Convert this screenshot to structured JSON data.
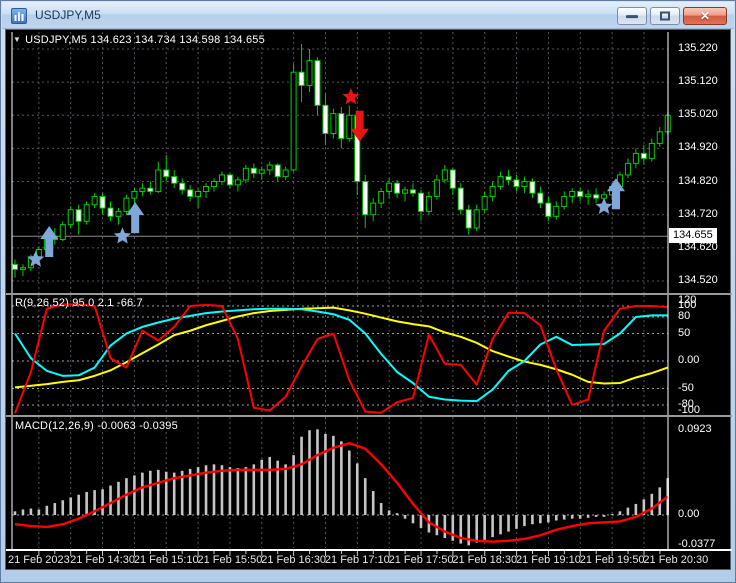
{
  "window": {
    "title": "USDJPY,M5",
    "buttons": {
      "minimize": "minimize",
      "restore": "restore",
      "close_glyph": "✕"
    }
  },
  "legend": {
    "arrow": "▼",
    "text": "USDJPY,M5 134.623 134.734 134.598 134.655"
  },
  "colors": {
    "background": "#000000",
    "grid": "#555562",
    "candle_outline": "#00CE00",
    "bull_fill": "#000000",
    "bear_fill": "#FFFFFF",
    "r_fast": "#FF0000",
    "r_mid": "#00FFFF",
    "r_slow": "#FFFF00",
    "macd_hist": "#C6C6C6",
    "macd_signal": "#FF0000",
    "marker_blue": "#7FA8D9",
    "marker_red": "#E81414",
    "frame": "#FFFFFF",
    "separator": "#9A9A9A",
    "price_line": "#8C8C8C",
    "axis_text": "#FFFFFF"
  },
  "chart_data": {
    "type": "candlestick",
    "symbol": "USDJPY",
    "timeframe": "M5",
    "last_ohlc": {
      "open": "134.623",
      "high": "134.734",
      "low": "134.598",
      "close": "134.655"
    },
    "current_price": 134.655,
    "price_ticks": [
      135.22,
      135.12,
      135.02,
      134.92,
      134.82,
      134.72,
      134.62,
      134.52
    ],
    "time_labels": [
      "21 Feb 2023",
      "21 Feb 14:30",
      "21 Feb 15:10",
      "21 Feb 15:50",
      "21 Feb 16:30",
      "21 Feb 17:10",
      "21 Feb 17:50",
      "21 Feb 18:30",
      "21 Feb 19:10",
      "21 Feb 19:50",
      "21 Feb 20:30"
    ],
    "candles": [
      [
        134.57,
        134.585,
        134.53,
        134.555
      ],
      [
        134.555,
        134.57,
        134.535,
        134.56
      ],
      [
        134.56,
        134.6,
        134.55,
        134.59
      ],
      [
        134.59,
        134.625,
        134.575,
        134.615
      ],
      [
        134.615,
        134.665,
        134.6,
        134.655
      ],
      [
        134.655,
        134.68,
        134.63,
        134.645
      ],
      [
        134.645,
        134.7,
        134.64,
        134.69
      ],
      [
        134.69,
        134.745,
        134.68,
        134.735
      ],
      [
        134.735,
        134.75,
        134.66,
        134.7
      ],
      [
        134.7,
        134.76,
        134.69,
        134.75
      ],
      [
        134.75,
        134.785,
        134.74,
        134.775
      ],
      [
        134.775,
        134.785,
        134.72,
        134.74
      ],
      [
        134.74,
        134.76,
        134.7,
        134.715
      ],
      [
        134.715,
        134.74,
        134.69,
        134.73
      ],
      [
        134.73,
        134.78,
        134.72,
        134.77
      ],
      [
        134.77,
        134.8,
        134.755,
        134.79
      ],
      [
        134.79,
        134.815,
        134.775,
        134.8
      ],
      [
        134.8,
        134.82,
        134.78,
        134.79
      ],
      [
        134.79,
        134.88,
        134.785,
        134.855
      ],
      [
        134.855,
        134.9,
        134.82,
        134.835
      ],
      [
        134.835,
        134.855,
        134.8,
        134.815
      ],
      [
        134.815,
        134.83,
        134.78,
        134.795
      ],
      [
        134.795,
        134.81,
        134.76,
        134.775
      ],
      [
        134.775,
        134.8,
        134.74,
        134.79
      ],
      [
        134.79,
        134.815,
        134.77,
        134.805
      ],
      [
        134.805,
        134.83,
        134.79,
        134.82
      ],
      [
        134.82,
        134.85,
        134.81,
        134.84
      ],
      [
        134.84,
        134.845,
        134.8,
        134.81
      ],
      [
        134.81,
        134.835,
        134.79,
        134.825
      ],
      [
        134.825,
        134.87,
        134.815,
        134.86
      ],
      [
        134.86,
        134.875,
        134.83,
        134.845
      ],
      [
        134.845,
        134.865,
        134.825,
        134.855
      ],
      [
        134.855,
        134.88,
        134.84,
        134.87
      ],
      [
        134.87,
        134.875,
        134.82,
        134.835
      ],
      [
        134.835,
        134.865,
        134.825,
        134.855
      ],
      [
        134.855,
        135.175,
        134.85,
        135.15
      ],
      [
        135.15,
        135.235,
        135.06,
        135.11
      ],
      [
        135.11,
        135.22,
        135.09,
        135.185
      ],
      [
        135.185,
        135.195,
        135.02,
        135.05
      ],
      [
        135.05,
        135.085,
        134.93,
        134.965
      ],
      [
        134.965,
        135.04,
        134.95,
        135.025
      ],
      [
        135.025,
        135.045,
        134.92,
        134.95
      ],
      [
        134.95,
        135.05,
        134.94,
        135.02
      ],
      [
        135.02,
        135.035,
        134.78,
        134.82
      ],
      [
        134.82,
        134.84,
        134.68,
        134.72
      ],
      [
        134.72,
        134.77,
        134.7,
        134.755
      ],
      [
        134.755,
        134.8,
        134.74,
        134.79
      ],
      [
        134.79,
        134.83,
        134.77,
        134.815
      ],
      [
        134.815,
        134.825,
        134.77,
        134.785
      ],
      [
        134.785,
        134.805,
        134.76,
        134.795
      ],
      [
        134.795,
        134.815,
        134.775,
        134.785
      ],
      [
        134.785,
        134.795,
        134.7,
        134.73
      ],
      [
        134.73,
        134.79,
        134.72,
        134.775
      ],
      [
        134.775,
        134.84,
        134.765,
        134.825
      ],
      [
        134.825,
        134.87,
        134.815,
        134.855
      ],
      [
        134.855,
        134.86,
        134.78,
        134.8
      ],
      [
        134.8,
        134.815,
        134.72,
        134.735
      ],
      [
        134.735,
        134.75,
        134.66,
        134.68
      ],
      [
        134.68,
        134.75,
        134.67,
        134.735
      ],
      [
        134.735,
        134.79,
        134.725,
        134.775
      ],
      [
        134.775,
        134.82,
        134.76,
        134.805
      ],
      [
        134.805,
        134.85,
        134.795,
        134.835
      ],
      [
        134.835,
        134.855,
        134.81,
        134.825
      ],
      [
        134.825,
        134.84,
        134.79,
        134.805
      ],
      [
        134.805,
        134.835,
        134.785,
        134.82
      ],
      [
        134.82,
        134.83,
        134.77,
        134.785
      ],
      [
        134.785,
        134.805,
        134.74,
        134.755
      ],
      [
        134.755,
        134.775,
        134.7,
        134.715
      ],
      [
        134.715,
        134.76,
        134.705,
        134.745
      ],
      [
        134.745,
        134.79,
        134.735,
        134.775
      ],
      [
        134.775,
        134.8,
        134.755,
        134.79
      ],
      [
        134.79,
        134.8,
        134.76,
        134.775
      ],
      [
        134.775,
        134.795,
        134.75,
        134.78
      ],
      [
        134.78,
        134.8,
        134.755,
        134.77
      ],
      [
        134.77,
        134.79,
        134.74,
        134.78
      ],
      [
        134.78,
        134.815,
        134.765,
        134.805
      ],
      [
        134.805,
        134.85,
        134.795,
        134.84
      ],
      [
        134.84,
        134.89,
        134.83,
        134.875
      ],
      [
        134.875,
        134.92,
        134.86,
        134.905
      ],
      [
        134.905,
        134.93,
        134.87,
        134.89
      ],
      [
        134.89,
        134.95,
        134.88,
        134.935
      ],
      [
        134.935,
        134.985,
        134.925,
        134.97
      ],
      [
        134.97,
        135.03,
        134.96,
        135.02
      ]
    ],
    "markers": [
      {
        "type": "star",
        "signal": "buy",
        "bar": 2.6,
        "price": 134.585
      },
      {
        "type": "arrow-up",
        "signal": "buy",
        "bar": 4.3,
        "price": 134.686
      },
      {
        "type": "star",
        "signal": "buy",
        "bar": 13.5,
        "price": 134.655
      },
      {
        "type": "arrow-up",
        "signal": "buy",
        "bar": 15.1,
        "price": 134.758
      },
      {
        "type": "star",
        "signal": "sell",
        "bar": 42.2,
        "price": 135.075
      },
      {
        "type": "arrow-down",
        "signal": "sell",
        "bar": 43.3,
        "price": 134.94
      },
      {
        "type": "star",
        "signal": "buy",
        "bar": 74.0,
        "price": 134.744
      },
      {
        "type": "arrow-up",
        "signal": "buy",
        "bar": 75.5,
        "price": 134.83
      }
    ],
    "r_indicator": {
      "label": "R(9,26,52) 95.0 2.1 -66.7",
      "sample_step": 2,
      "ticks": [
        {
          "v": 120,
          "label": "120",
          "grid": false
        },
        {
          "v": 100,
          "label": "100",
          "grid": true
        },
        {
          "v": 80,
          "label": "80",
          "grid": true
        },
        {
          "v": 50,
          "label": "50",
          "grid": true
        },
        {
          "v": 0,
          "label": "0.00",
          "grid": true
        },
        {
          "v": -50,
          "label": "-50",
          "grid": true
        },
        {
          "v": -80,
          "label": "-80",
          "grid": true
        },
        {
          "v": -100,
          "label": "-100",
          "grid": false
        }
      ],
      "fast": [
        -95,
        -20,
        95,
        103,
        103,
        100,
        5,
        -12,
        55,
        37,
        62,
        100,
        102,
        100,
        40,
        -85,
        -90,
        -65,
        -10,
        40,
        50,
        -35,
        -92,
        -94,
        -75,
        -67,
        48,
        -5,
        -7,
        -43,
        40,
        88,
        87,
        65,
        -15,
        -80,
        -70,
        55,
        95,
        100,
        100,
        98
      ],
      "mid": [
        50,
        5,
        -18,
        -27,
        -26,
        -12,
        28,
        50,
        62,
        70,
        77,
        82,
        87,
        90,
        92,
        94,
        95,
        95,
        94,
        90,
        85,
        75,
        50,
        13,
        -20,
        -40,
        -65,
        -70,
        -72,
        -73,
        -52,
        -18,
        0,
        30,
        44,
        29,
        30,
        31,
        50,
        80,
        83,
        83
      ],
      "slow": [
        -48,
        -45,
        -42,
        -38,
        -35,
        -27,
        -17,
        -2,
        14,
        30,
        47,
        55,
        65,
        73,
        81,
        87,
        91,
        93,
        95,
        96,
        97,
        92,
        86,
        79,
        72,
        67,
        63,
        52,
        44,
        33,
        18,
        8,
        -1,
        -7,
        -15,
        -25,
        -38,
        -41,
        -40,
        -30,
        -22,
        -12
      ]
    },
    "macd": {
      "label": "MACD(12,26,9) -0.0063 -0.0395",
      "sample_step": 2,
      "ticks": [
        {
          "v": 0.0923,
          "label": "0.0923",
          "grid": false
        },
        {
          "v": 0,
          "label": "0.00",
          "grid": true
        },
        {
          "v": -0.0377,
          "label": "-0.0377",
          "grid": false
        }
      ],
      "histogram": [
        0.004,
        0.006,
        0.007,
        0.006,
        0.01,
        0.013,
        0.016,
        0.019,
        0.022,
        0.025,
        0.027,
        0.028,
        0.032,
        0.036,
        0.04,
        0.043,
        0.046,
        0.048,
        0.049,
        0.047,
        0.046,
        0.048,
        0.05,
        0.052,
        0.054,
        0.055,
        0.054,
        0.052,
        0.051,
        0.052,
        0.055,
        0.06,
        0.063,
        0.059,
        0.055,
        0.065,
        0.085,
        0.092,
        0.093,
        0.088,
        0.086,
        0.08,
        0.07,
        0.056,
        0.04,
        0.026,
        0.013,
        0.005,
        0.002,
        -0.004,
        -0.009,
        -0.014,
        -0.019,
        -0.022,
        -0.025,
        -0.028,
        -0.031,
        -0.033,
        -0.03,
        -0.027,
        -0.024,
        -0.021,
        -0.018,
        -0.015,
        -0.012,
        -0.01,
        -0.009,
        -0.008,
        -0.006,
        -0.005,
        -0.004,
        -0.004,
        -0.003,
        -0.002,
        -0.002,
        0.001,
        0.004,
        0.008,
        0.012,
        0.017,
        0.023,
        0.03,
        0.04
      ],
      "signal": [
        -0.01,
        -0.012,
        -0.013,
        -0.01,
        -0.004,
        0.004,
        0.013,
        0.022,
        0.03,
        0.035,
        0.04,
        0.043,
        0.046,
        0.048,
        0.049,
        0.049,
        0.049,
        0.05,
        0.055,
        0.065,
        0.073,
        0.078,
        0.072,
        0.055,
        0.035,
        0.012,
        -0.008,
        -0.018,
        -0.025,
        -0.028,
        -0.029,
        -0.028,
        -0.026,
        -0.022,
        -0.016,
        -0.012,
        -0.009,
        -0.008,
        -0.007,
        -0.002,
        0.007,
        0.02
      ]
    }
  }
}
